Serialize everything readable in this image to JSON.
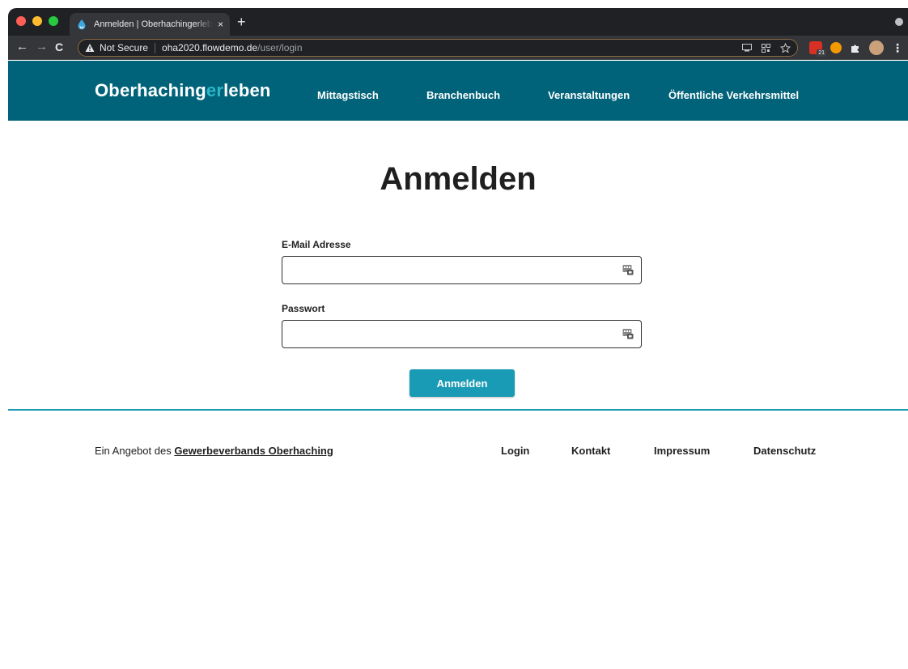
{
  "browser": {
    "tab_title": "Anmelden | Oberhachingerleben",
    "tab_close": "×",
    "new_tab": "+",
    "security_label": "Not Secure",
    "url_host": "oha2020.flowdemo.de",
    "url_path": "/user/login",
    "calendar_badge": "21",
    "menu": "⋮",
    "back": "←",
    "forward": "→",
    "reload": "C"
  },
  "site": {
    "logo_part1": "Oberhaching",
    "logo_accent": "er",
    "logo_part2": "leben",
    "nav": [
      {
        "label": "Mittagstisch"
      },
      {
        "label": "Branchenbuch"
      },
      {
        "label": "Veranstaltungen"
      },
      {
        "label": "Öffentliche Verkehrsmittel"
      }
    ],
    "colors": {
      "header": "#006379",
      "accent": "#1a9bb5",
      "logo_accent": "#2bb8c9"
    }
  },
  "login": {
    "title": "Anmelden",
    "email_label": "E-Mail Adresse",
    "email_value": "",
    "password_label": "Passwort",
    "password_value": "",
    "submit_label": "Anmelden"
  },
  "footer": {
    "offer_prefix": "Ein Angebot des ",
    "offer_link": "Gewerbeverbands Oberhaching",
    "links": [
      {
        "label": "Login"
      },
      {
        "label": "Kontakt"
      },
      {
        "label": "Impressum"
      },
      {
        "label": "Datenschutz"
      }
    ]
  }
}
